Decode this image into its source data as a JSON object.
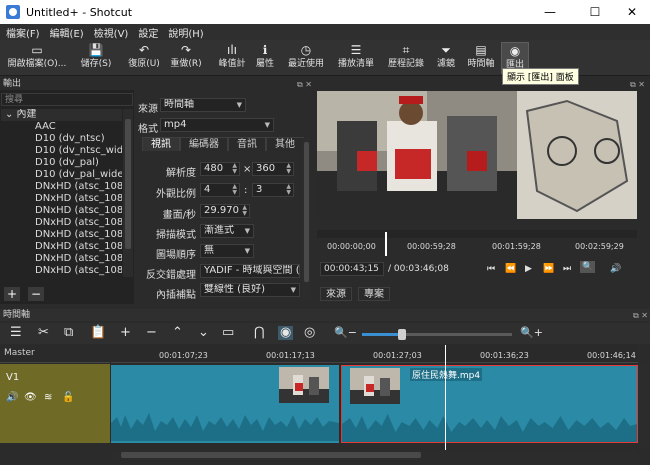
{
  "window": {
    "title": "Untitled+ - Shotcut",
    "minimize": "—",
    "maximize": "☐",
    "close": "✕"
  },
  "menu": [
    "檔案(F)",
    "編輯(E)",
    "檢視(V)",
    "設定",
    "說明(H)"
  ],
  "toolbar": [
    {
      "icon": "▭",
      "label": "開啟檔案(O)...",
      "name": "open-file-button"
    },
    {
      "icon": "💾",
      "label": "儲存(S)",
      "name": "save-button"
    },
    {
      "icon": "↶",
      "label": "復原(U)",
      "name": "undo-button"
    },
    {
      "icon": "↷",
      "label": "重做(R)",
      "name": "redo-button"
    },
    {
      "icon": "ılı",
      "label": "峰值計",
      "name": "peak-meter-button"
    },
    {
      "icon": "ℹ",
      "label": "屬性",
      "name": "properties-button"
    },
    {
      "icon": "◷",
      "label": "最近使用",
      "name": "recent-button"
    },
    {
      "icon": "☰",
      "label": "播放清單",
      "name": "playlist-button"
    },
    {
      "icon": "⌗",
      "label": "歷程記錄",
      "name": "history-button"
    },
    {
      "icon": "⏷",
      "label": "濾鏡",
      "name": "filters-button"
    },
    {
      "icon": "▤",
      "label": "時間軸",
      "name": "timeline-button"
    },
    {
      "icon": "◉",
      "label": "匯出",
      "name": "export-button"
    }
  ],
  "tooltip": "顯示 [匯出] 面板",
  "export": {
    "panel_title": "輸出",
    "search_placeholder": "搜尋",
    "presets": [
      "⌄ 內建",
      "AAC",
      "D10 (dv_ntsc)",
      "D10 (dv_ntsc_wide)",
      "D10 (dv_pal)",
      "D10 (dv_pal_wide)",
      "DNxHD (atsc_108...",
      "DNxHD (atsc_108...",
      "DNxHD (atsc_108...",
      "DNxHD (atsc_108...",
      "DNxHD (atsc_108...",
      "DNxHD (atsc_108...",
      "DNxHD (atsc_108...",
      "DNxHD (atsc_108..."
    ],
    "add": "+",
    "remove": "−",
    "source_label": "來源",
    "source_value": "時間軸",
    "format_label": "格式",
    "format_value": "mp4",
    "tabs": [
      "視訊",
      "編碼器",
      "音訊",
      "其他"
    ],
    "resolution_label": "解析度",
    "width": "480",
    "height": "360",
    "times": "×",
    "aspect_label": "外觀比例",
    "aspect_w": "4",
    "aspect_h": "3",
    "colon": ":",
    "fps_label": "畫面/秒",
    "fps": "29.970",
    "scan_label": "掃描模式",
    "scan_value": "漸進式",
    "field_label": "圖場順序",
    "field_value": "無",
    "deinterlace_label": "反交錯處理",
    "deinterlace_value": "YADIF - 時域與空間 (最",
    "interp_label": "內插補點",
    "interp_value": "雙線性 (良好)"
  },
  "player": {
    "ruler": [
      "00:00:00;00",
      "00:00:59;28",
      "00:01:59;28",
      "00:02:59;29"
    ],
    "current": "00:00:43;15",
    "total": "/ 00:03:46;08",
    "controls": [
      "⏮",
      "⏪",
      "▶",
      "⏩",
      "⏭",
      "⧉"
    ],
    "zoom": "🔍",
    "volume": "🔊",
    "source_tab": "來源",
    "project_tab": "專案"
  },
  "timeline": {
    "panel_title": "時間軸",
    "master": "Master",
    "track": "V1",
    "ruler": [
      "00:01:07;23",
      "00:01:17;13",
      "00:01:27;03",
      "00:01:36;23",
      "00:01:46;14"
    ],
    "clip2_label": "原住民熱舞.mp4",
    "tools": [
      "☰",
      "✂",
      "⧉",
      "📋",
      "+",
      "−",
      "⌃",
      "⌄",
      "▭",
      "⋂",
      "◉",
      "◎",
      "🔍−",
      "🔍+"
    ]
  }
}
